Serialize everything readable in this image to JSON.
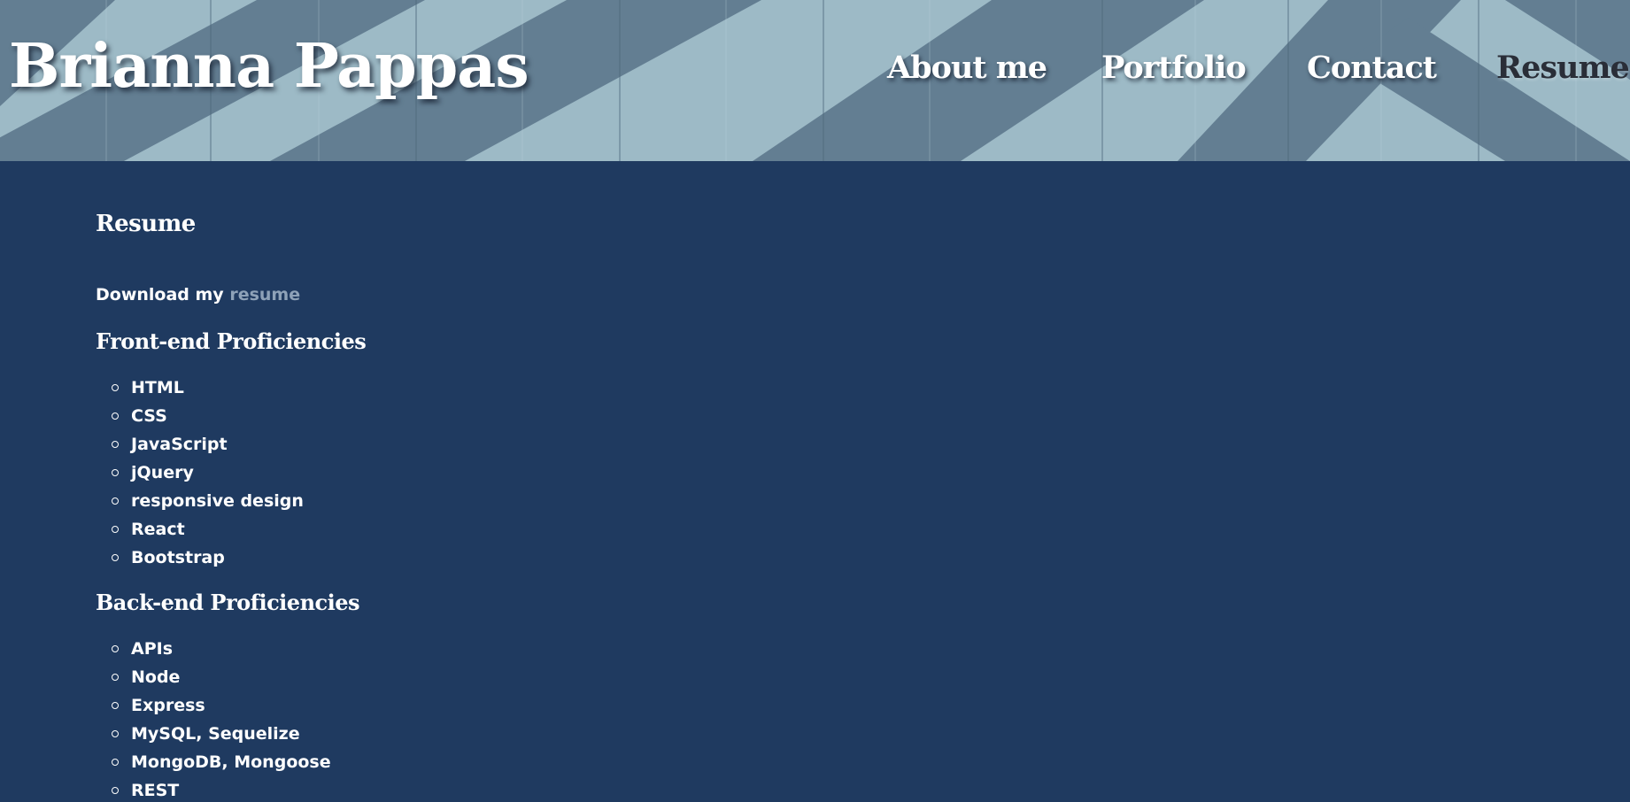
{
  "brand": {
    "name": "Brianna Pappas"
  },
  "nav": {
    "items": [
      {
        "label": "About me"
      },
      {
        "label": "Portfolio"
      },
      {
        "label": "Contact"
      },
      {
        "label": "Resume"
      }
    ],
    "active": "Resume"
  },
  "page": {
    "title": "Resume",
    "download_prefix": "Download my",
    "download_link": "resume"
  },
  "frontend": {
    "title": "Front-end Proficiencies",
    "items": [
      "HTML",
      "CSS",
      "JavaScript",
      "jQuery",
      "responsive design",
      "React",
      "Bootstrap"
    ]
  },
  "backend": {
    "title": "Back-end Proficiencies",
    "items": [
      "APIs",
      "Node",
      "Express",
      "MySQL, Sequelize",
      "MongoDB, Mongoose",
      "REST"
    ]
  },
  "colors": {
    "background": "#1f3a60",
    "header_light": "#9dbac6",
    "header_dark": "#5f7a8e",
    "link_muted": "#8ea2b8",
    "active_nav": "#2a2e38"
  }
}
